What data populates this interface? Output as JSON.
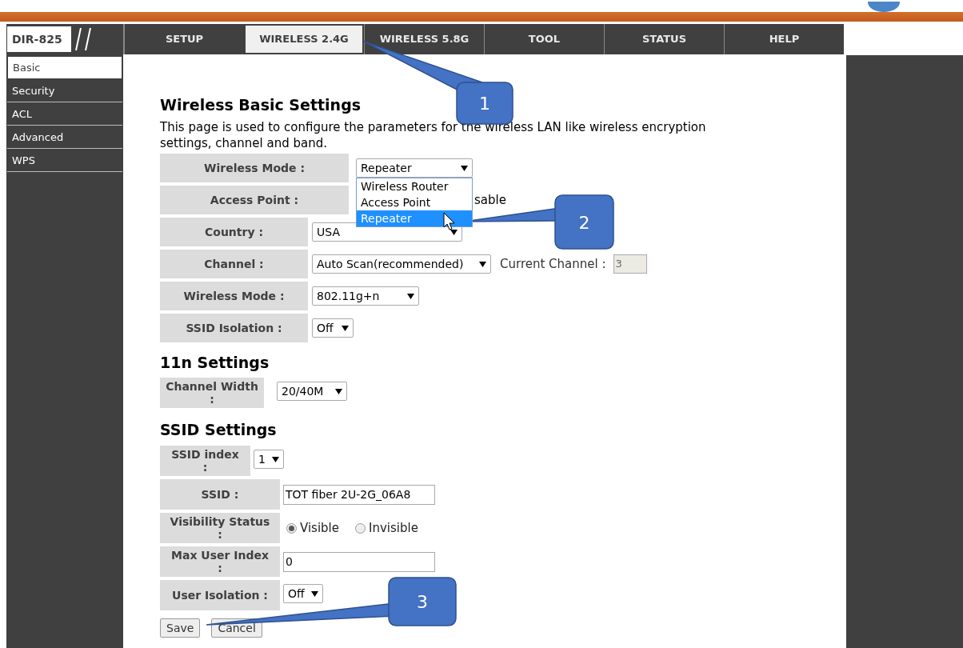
{
  "logo": "DIR-825",
  "tabs": [
    {
      "label": "SETUP",
      "selected": false
    },
    {
      "label": "WIRELESS 2.4G",
      "selected": true
    },
    {
      "label": "WIRELESS 5.8G",
      "selected": false
    },
    {
      "label": "TOOL",
      "selected": false
    },
    {
      "label": "STATUS",
      "selected": false
    },
    {
      "label": "HELP",
      "selected": false
    }
  ],
  "sidebar": {
    "items": [
      {
        "label": "Basic",
        "selected": true
      },
      {
        "label": "Security",
        "selected": false
      },
      {
        "label": "ACL",
        "selected": false
      },
      {
        "label": "Advanced",
        "selected": false
      },
      {
        "label": "WPS",
        "selected": false
      }
    ]
  },
  "page": {
    "title": "Wireless Basic Settings",
    "description": "This page is used to configure the parameters for the wireless LAN like wireless encryption settings, channel and band."
  },
  "basic_rows": [
    {
      "kind": "select",
      "label": "Wireless Mode :",
      "value": "Repeater",
      "open": true,
      "options": [
        {
          "label": "Wireless Router",
          "selected": false
        },
        {
          "label": "Access Point",
          "selected": false
        },
        {
          "label": "Repeater",
          "selected": true
        }
      ]
    },
    {
      "kind": "text",
      "label": "Access Point :",
      "value": "sable"
    },
    {
      "kind": "select",
      "label": "Country :",
      "value": "USA"
    },
    {
      "kind": "select",
      "label": "Channel :",
      "value": "Auto Scan(recommended)",
      "extra_label": "Current Channel :",
      "extra_value": "3"
    },
    {
      "kind": "select",
      "label": "Wireless Mode :",
      "value": "802.11g+n"
    },
    {
      "kind": "select",
      "label": "SSID Isolation :",
      "value": "Off"
    }
  ],
  "sections": [
    {
      "title": "11n Settings",
      "rows": [
        {
          "kind": "select",
          "label_lines": [
            "Channel Width",
            ":"
          ],
          "value": "20/40M"
        }
      ]
    },
    {
      "title": "SSID Settings",
      "rows": [
        {
          "kind": "select",
          "label_lines": [
            "SSID index",
            ":"
          ],
          "value": "1"
        },
        {
          "kind": "input",
          "label_lines": [
            "SSID :"
          ],
          "value": "TOT fiber 2U-2G_06A8"
        },
        {
          "kind": "radio",
          "label_lines": [
            "Visibility Status",
            ":"
          ],
          "options": [
            {
              "label": "Visible",
              "selected": true
            },
            {
              "label": "Invisible",
              "selected": false
            }
          ]
        },
        {
          "kind": "input",
          "label_lines": [
            "Max User Index",
            ":"
          ],
          "value": "0"
        },
        {
          "kind": "select",
          "label_lines": [
            "User Isolation :"
          ],
          "value": "Off"
        }
      ]
    }
  ],
  "buttons": [
    "Save",
    "Cancel"
  ],
  "callouts": [
    "1",
    "2",
    "3"
  ]
}
